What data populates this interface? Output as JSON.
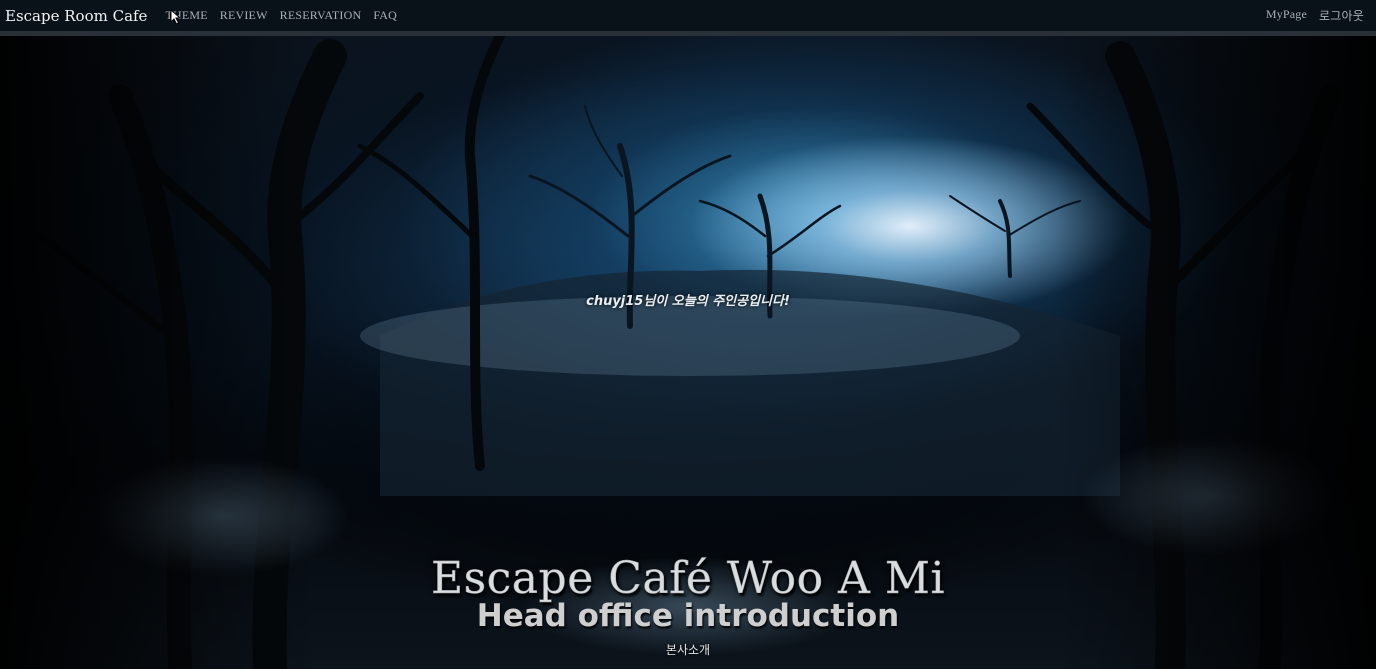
{
  "navbar": {
    "brand": "Escape Room Cafe",
    "links": [
      "THEME",
      "REVIEW",
      "RESERVATION",
      "FAQ"
    ],
    "right": {
      "mypage": "MyPage",
      "logout": "로그아웃"
    }
  },
  "hero": {
    "welcome": "chuyj15님이 오늘의 주인공입니다!",
    "title": "Escape Café Woo A Mi",
    "subtitle": "Head office introduction",
    "korean_label": "본사소개"
  },
  "colors": {
    "navbar_bg": "#0a1219",
    "nav_text": "#a9b0b6",
    "brand_text": "#f2f2f2"
  },
  "icons": [
    "mouse-pointer-icon"
  ]
}
